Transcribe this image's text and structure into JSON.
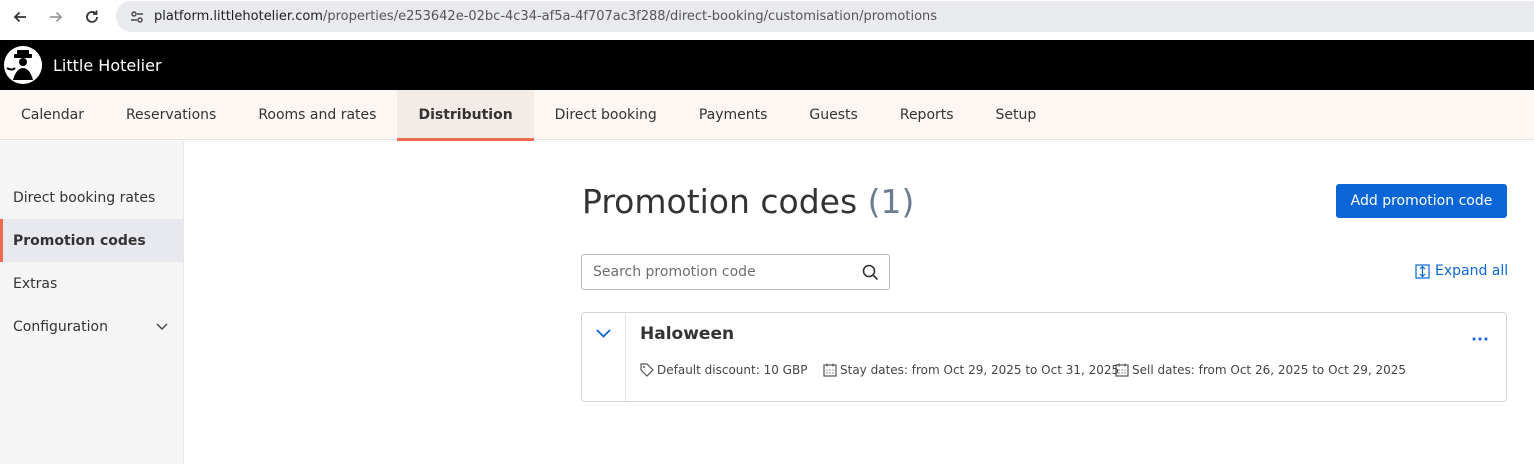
{
  "browser": {
    "url_host": "platform.littlehotelier.com",
    "url_path": "/properties/e253642e-02bc-4c34-af5a-4f707ac3f288/direct-booking/customisation/promotions"
  },
  "header": {
    "app_title": "Little Hotelier"
  },
  "nav": {
    "tabs": [
      {
        "label": "Calendar"
      },
      {
        "label": "Reservations"
      },
      {
        "label": "Rooms and rates"
      },
      {
        "label": "Distribution",
        "active": true
      },
      {
        "label": "Direct booking"
      },
      {
        "label": "Payments"
      },
      {
        "label": "Guests"
      },
      {
        "label": "Reports"
      },
      {
        "label": "Setup"
      }
    ]
  },
  "sidebar": {
    "items": [
      {
        "label": "Direct booking rates"
      },
      {
        "label": "Promotion codes",
        "active": true
      },
      {
        "label": "Extras"
      },
      {
        "label": "Configuration"
      }
    ]
  },
  "main": {
    "title": "Promotion codes",
    "count": "(1)",
    "add_button": "Add promotion code",
    "search_placeholder": "Search promotion code",
    "expand_all": "Expand all",
    "promotions": [
      {
        "name": "Haloween",
        "discount": "Default discount: 10 GBP",
        "stay_dates": "Stay dates: from Oct 29, 2025 to Oct 31, 2025",
        "sell_dates": "Sell dates: from Oct 26, 2025 to Oct 29, 2025"
      }
    ]
  },
  "colors": {
    "accent": "#ef6a4d",
    "primary": "#0a66d6",
    "header_bg": "#000000"
  },
  "icons": [
    "back-arrow-icon",
    "forward-arrow-icon",
    "reload-icon",
    "site-settings-icon",
    "chevron-down-icon",
    "search-icon",
    "expand-icon",
    "tag-icon",
    "calendar-icon",
    "more-icon"
  ]
}
